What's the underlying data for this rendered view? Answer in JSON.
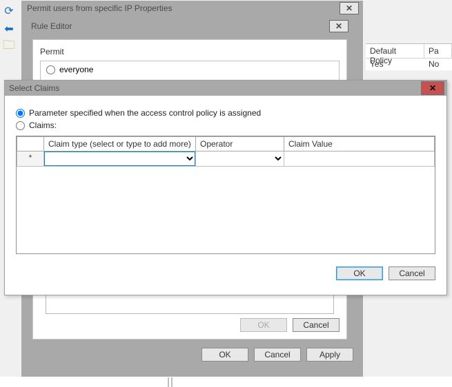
{
  "toolbar": {
    "back_label": "Back",
    "folder_label": "Open"
  },
  "right_list": {
    "cols": {
      "policy": "Default Policy",
      "p2": "Pa"
    },
    "row": {
      "policy": "Yes",
      "p2": "No"
    }
  },
  "props": {
    "title": "Permit users from specific IP Properties",
    "buttons": {
      "ok": "OK",
      "cancel": "Cancel",
      "apply": "Apply"
    }
  },
  "rule": {
    "title": "Rule Editor",
    "permit_label": "Permit",
    "option_everyone": "everyone",
    "buttons": {
      "ok": "OK",
      "cancel": "Cancel"
    }
  },
  "claims": {
    "title": "Select Claims",
    "opt_parameter": "Parameter specified when the access control policy is assigned",
    "opt_claims": "Claims:",
    "selected": "parameter",
    "grid": {
      "headers": {
        "row": "",
        "claim_type": "Claim type (select or type to add more)",
        "operator": "Operator",
        "claim_value": "Claim Value"
      },
      "new_row_marker": "*",
      "row": {
        "claim_type": "",
        "operator": "",
        "claim_value": ""
      }
    },
    "buttons": {
      "ok": "OK",
      "cancel": "Cancel"
    }
  }
}
